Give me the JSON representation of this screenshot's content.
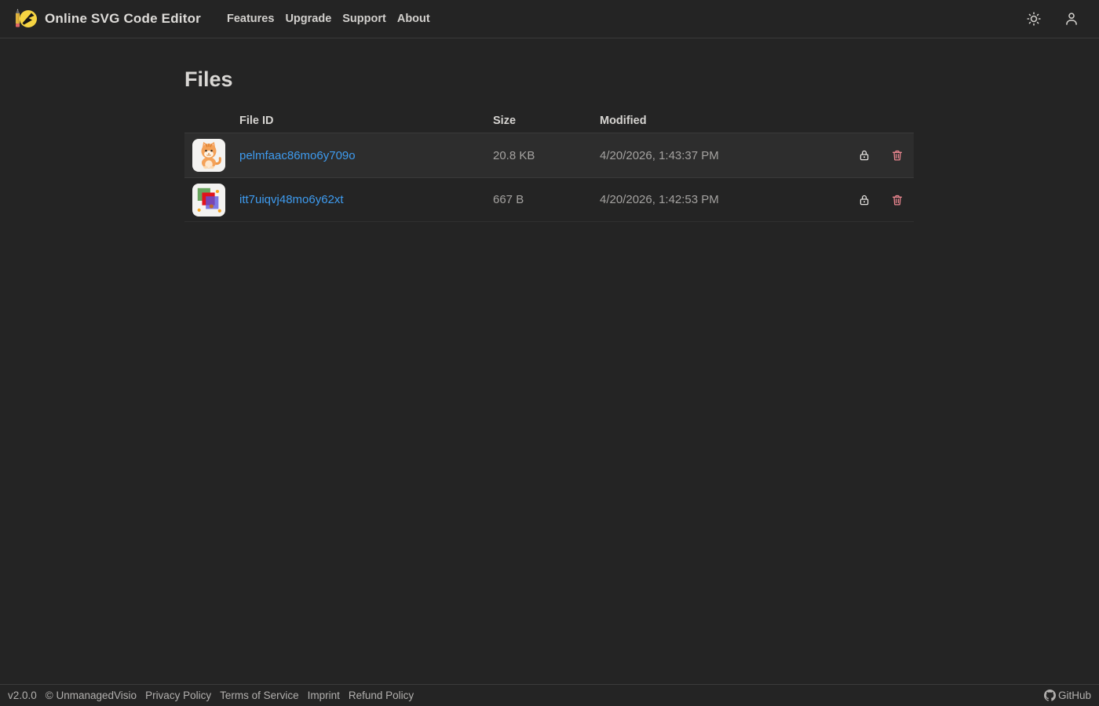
{
  "navbar": {
    "brand": "Online SVG Code Editor",
    "links": [
      "Features",
      "Upgrade",
      "Support",
      "About"
    ],
    "icons": [
      "pencil-ball-logo",
      "sun-icon",
      "person-icon"
    ]
  },
  "page": {
    "title": "Files"
  },
  "table": {
    "columns": [
      "File ID",
      "Size",
      "Modified"
    ],
    "rows": [
      {
        "thumbnail": "cat-illustration",
        "file_id": "pelmfaac86mo6y709o",
        "size": "20.8 KB",
        "modified": "4/20/2026, 1:43:37 PM",
        "actions": [
          "lock-icon",
          "trash-icon"
        ]
      },
      {
        "thumbnail": "overlapping-colored-squares",
        "file_id": "itt7uiqvj48mo6y62xt",
        "size": "667 B",
        "modified": "4/20/2026, 1:42:53 PM",
        "actions": [
          "lock-icon",
          "trash-icon"
        ]
      }
    ]
  },
  "footer": {
    "version": "v2.0.0",
    "copyright": "© UnmanagedVisio",
    "links": [
      "Privacy Policy",
      "Terms of Service",
      "Imprint",
      "Refund Policy"
    ],
    "github_label": "GitHub"
  },
  "colors": {
    "background": "#242424",
    "link_blue": "#3e9bef",
    "danger_pink": "#ea868f",
    "row_hover": "#2d2d2d"
  }
}
